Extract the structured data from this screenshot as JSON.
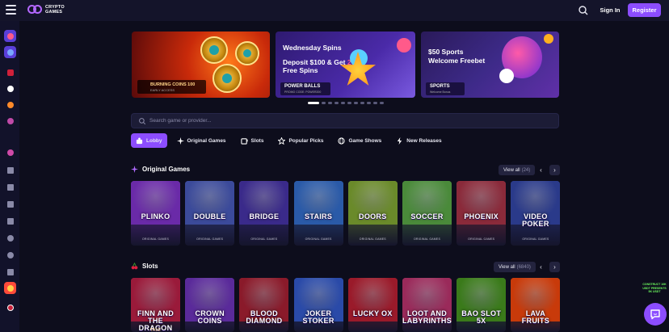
{
  "brand": {
    "line1": "CRYPTO",
    "line2": "GAMES"
  },
  "header": {
    "signin_label": "Sign In",
    "register_label": "Register"
  },
  "sidebar": {
    "items": [
      "casino-icon",
      "originals-icon",
      "slots-icon",
      "sports-icon",
      "basketball-icon",
      "tennis-icon",
      "esports-icon",
      "promotions-icon",
      "gift-icon",
      "vip-icon",
      "wallet-icon",
      "loyalty-icon",
      "affiliate-icon",
      "download-icon",
      "language-icon"
    ]
  },
  "banners": [
    {
      "title": "BURNING COINS 100",
      "subtitle": "EARLY ACCESS"
    },
    {
      "line1": "Wednesday Spins",
      "line2a": "Deposit $100 & Get",
      "line2b": "200",
      "line2c": "Free Spins",
      "tag": "POWER BALLS",
      "tag_sub": "PROMO CODE: POWER200"
    },
    {
      "line1": "$50 Sports",
      "line2": "Welcome Freebet",
      "tag": "SPORTS",
      "tag_sub": "Welcome Bonus"
    }
  ],
  "carousel": {
    "total": 11,
    "active": 0
  },
  "search": {
    "placeholder": "Search game or provider..."
  },
  "tabs": [
    {
      "label": "Lobby",
      "icon": "lobby-icon",
      "active": true
    },
    {
      "label": "Original Games",
      "icon": "sparkle-icon",
      "active": false
    },
    {
      "label": "Slots",
      "icon": "slot-machine-icon",
      "active": false
    },
    {
      "label": "Popular Picks",
      "icon": "star-icon",
      "active": false
    },
    {
      "label": "Game Shows",
      "icon": "globe-icon",
      "active": false
    },
    {
      "label": "New Releases",
      "icon": "bolt-icon",
      "active": false
    }
  ],
  "original_games": {
    "title": "Original Games",
    "view_all": "View all",
    "count": "(24)",
    "items": [
      {
        "name": "PLINKO",
        "provider": "ORIGINAL GAMES",
        "color": "#6a2aa8"
      },
      {
        "name": "DOUBLE",
        "provider": "ORIGINAL GAMES",
        "color": "#3b4a9a"
      },
      {
        "name": "BRIDGE",
        "provider": "ORIGINAL GAMES",
        "color": "#3a2a8a"
      },
      {
        "name": "STAIRS",
        "provider": "ORIGINAL GAMES",
        "color": "#2a5aa8"
      },
      {
        "name": "DOORS",
        "provider": "ORIGINAL GAMES",
        "color": "#6a8a2a"
      },
      {
        "name": "SOCCER",
        "provider": "ORIGINAL GAMES",
        "color": "#4a8a3a"
      },
      {
        "name": "PHOENIX",
        "provider": "ORIGINAL GAMES",
        "color": "#8a2a3a"
      },
      {
        "name": "VIDEO POKER",
        "provider": "ORIGINAL GAMES",
        "color": "#2a3a8a"
      }
    ]
  },
  "slots": {
    "title": "Slots",
    "view_all": "View all",
    "count": "(6840)",
    "items": [
      {
        "name": "FINN AND THE DRAGON",
        "sub": "TALE",
        "color": "#9a1a3a"
      },
      {
        "name": "CROWN COINS",
        "sub": "",
        "color": "#5a2a9a"
      },
      {
        "name": "BLOOD DIAMOND",
        "sub": "",
        "color": "#8a1a2a"
      },
      {
        "name": "JOKER STOKER",
        "sub": "",
        "color": "#2a4aa8"
      },
      {
        "name": "LUCKY OX",
        "sub": "",
        "color": "#9a1a2a"
      },
      {
        "name": "LOOT AND LABYRINTHS",
        "sub": "",
        "color": "#9a2a5a"
      },
      {
        "name": "BAO SLOT 5X",
        "sub": "",
        "color": "#3a7a1a"
      },
      {
        "name": "LAVA FRUITS",
        "sub": "",
        "color": "#c83a0a"
      }
    ]
  },
  "promo": {
    "text": "CONSTRUCT 10K USDT PRESENTS 5K USDT"
  }
}
